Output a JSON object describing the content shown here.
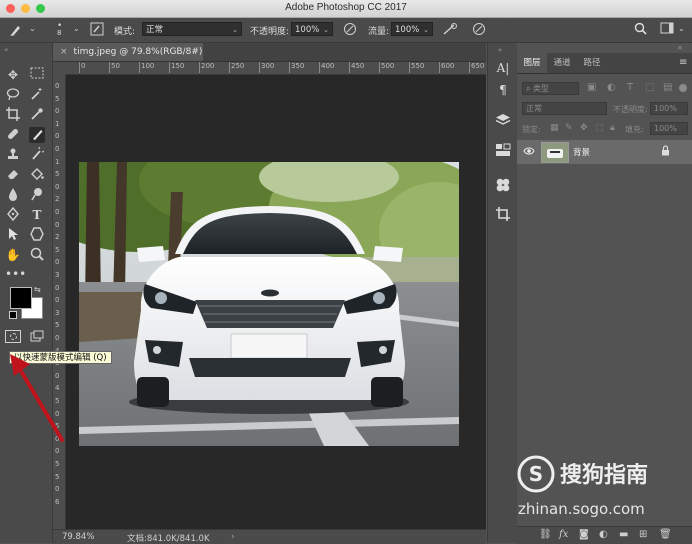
{
  "window": {
    "title": "Adobe Photoshop CC 2017"
  },
  "options_bar": {
    "brush_size": "8",
    "mode_label": "模式:",
    "mode_value": "正常",
    "opacity_label": "不透明度:",
    "opacity_value": "100%",
    "flow_label": "流量:",
    "flow_value": "100%"
  },
  "document": {
    "tab_title": "timg.jpeg @ 79.8%(RGB/8#)",
    "ruler_h_ticks": [
      "0",
      "50",
      "100",
      "150",
      "200",
      "250",
      "300",
      "350",
      "400",
      "450",
      "500",
      "550",
      "600",
      "650"
    ],
    "ruler_v_ticks": [
      "0",
      "5",
      "0",
      "1",
      "0",
      "0",
      "1",
      "5",
      "0",
      "2",
      "0",
      "0",
      "2",
      "5",
      "0",
      "3",
      "0",
      "0",
      "3",
      "5",
      "0",
      "4",
      "0",
      "0",
      "4",
      "5",
      "0",
      "5",
      "0",
      "0",
      "5",
      "5",
      "0",
      "6"
    ]
  },
  "tooltip": {
    "text": "以快速蒙版模式编辑 (Q)"
  },
  "status_bar": {
    "zoom": "79.84%",
    "doc_info": "文档:841.0K/841.0K"
  },
  "layers_panel": {
    "tabs": [
      "图层",
      "通道",
      "路径"
    ],
    "active_tab": 0,
    "filter_label": "类型",
    "blend_mode": "正常",
    "opacity_label": "不透明度:",
    "opacity_value": "100%",
    "lock_label": "锁定:",
    "fill_label": "填充:",
    "fill_value": "100%",
    "layers": [
      {
        "name": "背景",
        "visible": true,
        "locked": true
      }
    ]
  },
  "watermark": {
    "brand": "搜狗指南",
    "domain": "zhinan.sogo.com"
  },
  "colors": {
    "foreground": "#000000",
    "background": "#ffffff",
    "tooltip_bg": "#fbfbd8",
    "annotation_arrow": "#c0141c",
    "traffic_close": "#fc605b",
    "traffic_min": "#fdbc40",
    "traffic_max": "#34c84a"
  },
  "icons": {
    "toolbar": [
      "move-icon",
      "marquee-icon",
      "lasso-icon",
      "magic-wand-icon",
      "crop-icon",
      "eyedropper-icon",
      "healing-brush-icon",
      "brush-icon",
      "clone-stamp-icon",
      "history-brush-icon",
      "eraser-icon",
      "paint-bucket-icon",
      "blur-icon",
      "dodge-icon",
      "pen-icon",
      "type-icon",
      "path-select-icon",
      "shape-icon",
      "hand-icon",
      "zoom-icon",
      "more-tools-icon"
    ]
  }
}
